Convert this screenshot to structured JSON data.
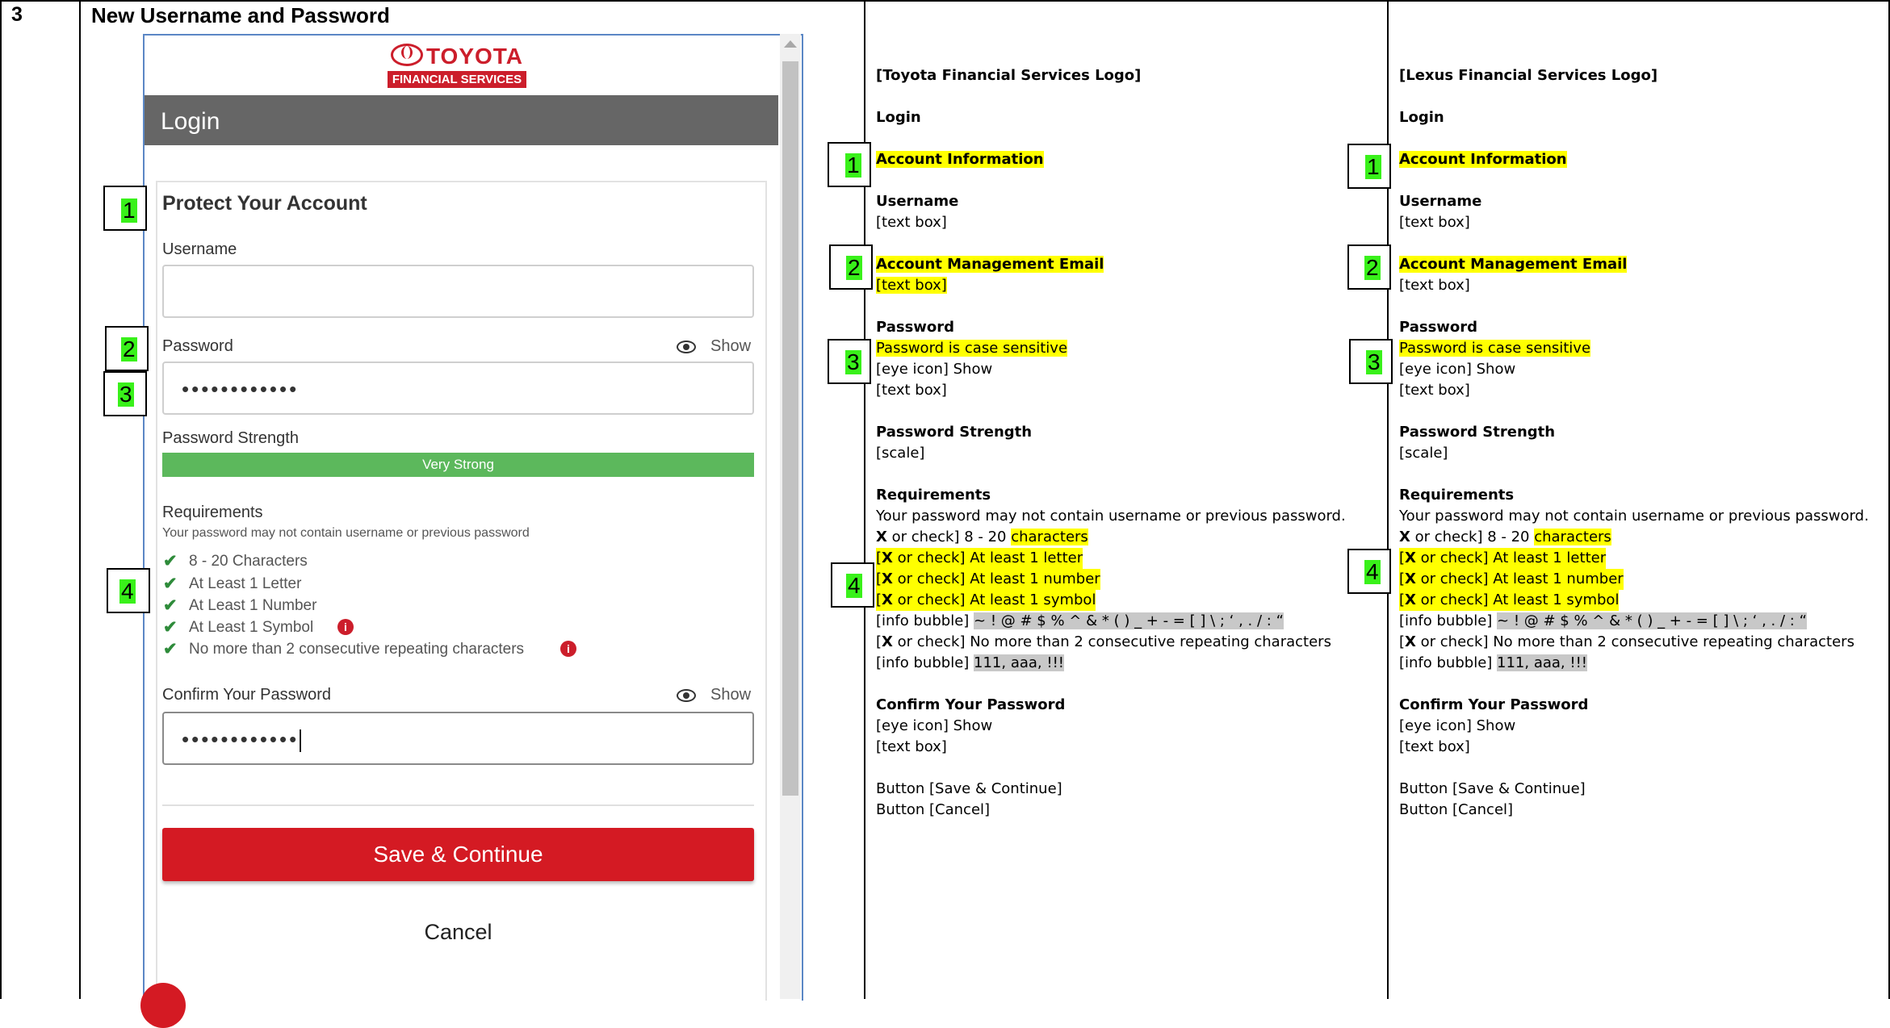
{
  "row": {
    "number": "3",
    "title": "New Username and Password"
  },
  "screenshot": {
    "logo": {
      "brand": "TOYOTA",
      "subtitle": "FINANCIAL SERVICES"
    },
    "header": "Login",
    "section_title": "Protect Your Account",
    "username_label": "Username",
    "username_value": "",
    "password_label": "Password",
    "show_label": "Show",
    "password_value": "••••••••••••",
    "strength_label": "Password Strength",
    "strength_value": "Very Strong",
    "strength_level": 1.0,
    "requirements_title": "Requirements",
    "requirements_subtitle": "Your password may not contain username or previous password",
    "requirements": [
      "8 - 20 Characters",
      "At Least 1 Letter",
      "At Least 1 Number",
      "At Least 1 Symbol",
      "No more than 2 consecutive repeating characters"
    ],
    "confirm_label": "Confirm Your Password",
    "confirm_value": "••••••••••••",
    "save_button": "Save & Continue",
    "cancel_button": "Cancel",
    "markers": [
      "1",
      "2",
      "3",
      "4"
    ]
  },
  "toyota_spec": {
    "logo": "[Toyota Financial Services Logo]",
    "login": "Login",
    "account_info": "Account Information",
    "username": "Username",
    "text_box": "[text box]",
    "acct_email": "Account Management Email",
    "password": "Password",
    "case_sensitive": "Password is case sensitive",
    "eye_show": "[eye icon] Show",
    "strength": "Password Strength",
    "scale": "[scale]",
    "requirements": "Requirements",
    "req_note": "Your password may not contain username or previous password.",
    "req_x": "X",
    "req_chars_pre": " or check] 8 - 20 ",
    "req_chars_hl": "characters",
    "req_letter_b": "[",
    "req_letter_rest": " or check] At least 1 letter",
    "req_number_rest": " or check] At least 1 number",
    "req_symbol_rest": " or check] At least 1 symbol",
    "info_bubble": "[info bubble]",
    "symbols": " ~ ! @ # $ % ^ & * ( ) _ + - = [ ] \\ ; ‘ , . / : “",
    "repeat_pre": "[",
    "repeat_rest": " or check] No more than 2 consecutive repeating characters",
    "repeat_examples": "111, aaa, !!!",
    "confirm": "Confirm Your Password",
    "btn_save": "Button [Save & Continue]",
    "btn_cancel": "Button [Cancel]"
  },
  "lexus_spec": {
    "logo": "[Lexus Financial Services Logo]"
  }
}
